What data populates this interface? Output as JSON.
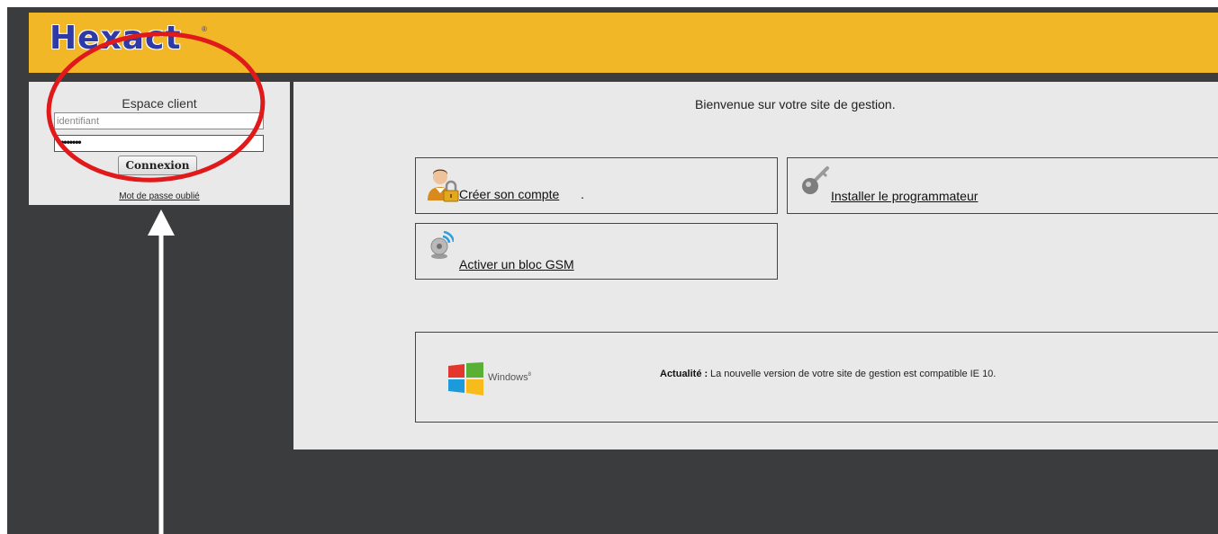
{
  "header": {
    "logo_text": "Hexact",
    "logo_reg": "®"
  },
  "login": {
    "title": "Espace client",
    "username_placeholder": "identifiant",
    "password_mask": "••••••••",
    "submit_label": "Connexion",
    "forgot_link": "Mot de passe oublié"
  },
  "main": {
    "welcome": "Bienvenue sur votre site de gestion.",
    "actions": [
      {
        "label": "Créer son compte",
        "suffix": ".",
        "icon": "user-lock-icon"
      },
      {
        "label": "Installer le programmateur",
        "icon": "key-icon"
      },
      {
        "label": "Activer un bloc GSM",
        "icon": "gsm-signal-icon"
      }
    ],
    "news": {
      "logo_text": "Windows",
      "logo_superscript": "8",
      "label": "Actualité :",
      "text": "La nouvelle version de votre site de gestion est compatible IE 10."
    }
  },
  "colors": {
    "header_bg": "#f1b726",
    "frame_bg": "#3b3c3e",
    "panel_bg": "#e9e9e9",
    "logo_blue": "#2f3aa6",
    "annotation_red": "#e0191b"
  }
}
